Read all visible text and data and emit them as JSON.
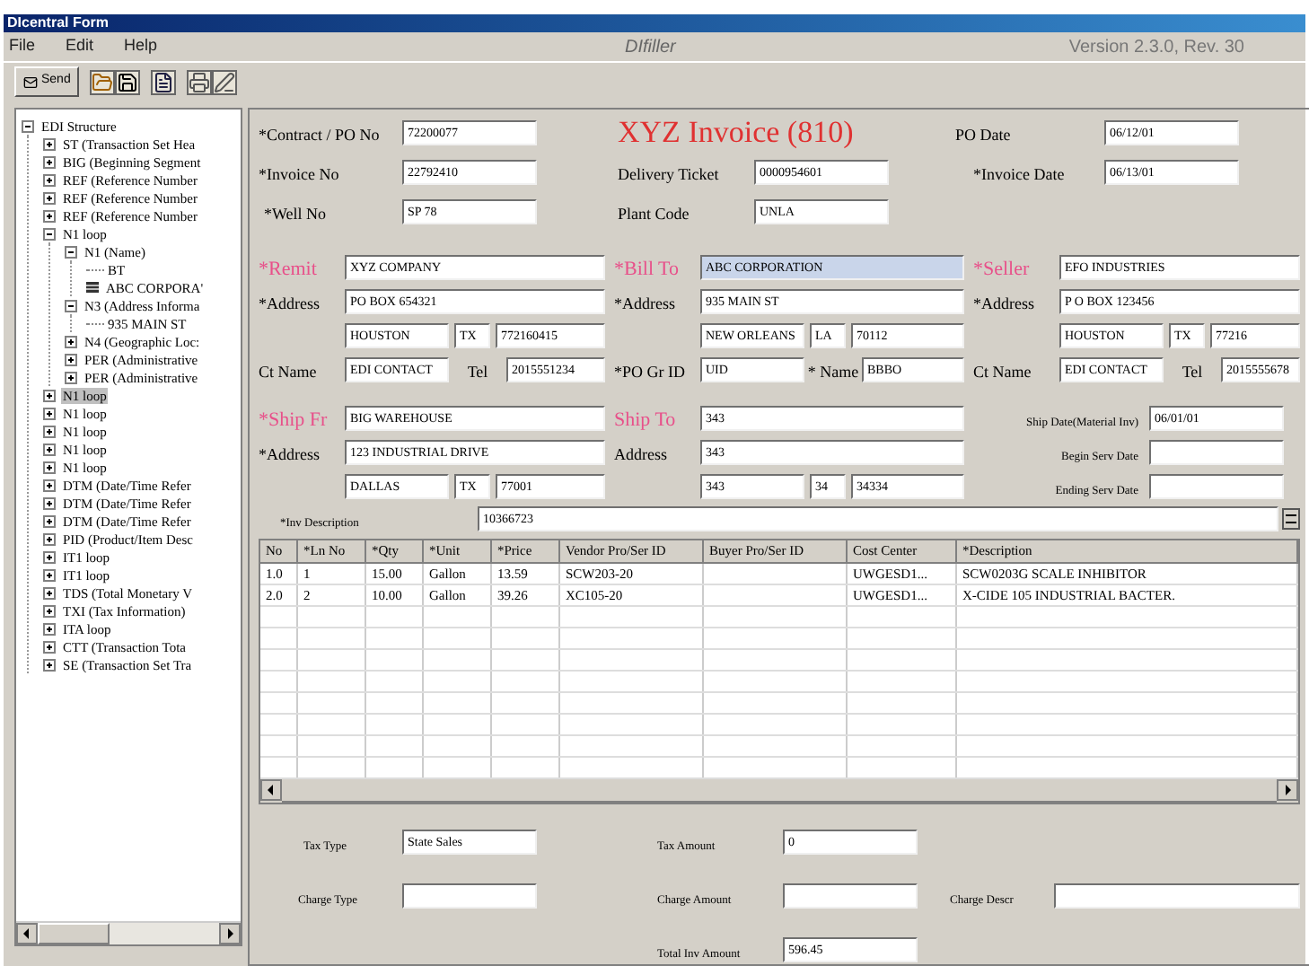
{
  "window": {
    "title": "DIcentral Form"
  },
  "menu": [
    "File",
    "Edit",
    "Help"
  ],
  "app_name": "DIfiller",
  "version": "Version 2.3.0, Rev. 30",
  "toolbar": {
    "send_label": "Send"
  },
  "tree": [
    {
      "label": "EDI Structure",
      "kind": "node",
      "expanded": true,
      "selected": false,
      "children": [
        {
          "label": "ST (Transaction Set Hea",
          "kind": "node",
          "expanded": false,
          "selected": false
        },
        {
          "label": "BIG (Beginning Segment",
          "kind": "node",
          "expanded": false,
          "selected": false
        },
        {
          "label": "REF (Reference Number",
          "kind": "node",
          "expanded": false,
          "selected": false
        },
        {
          "label": "REF (Reference Number",
          "kind": "node",
          "expanded": false,
          "selected": false
        },
        {
          "label": "REF (Reference Number",
          "kind": "node",
          "expanded": false,
          "selected": false
        },
        {
          "label": "N1 loop",
          "kind": "node",
          "expanded": true,
          "selected": false,
          "children": [
            {
              "label": "N1 (Name)",
              "kind": "node",
              "expanded": true,
              "selected": false,
              "children": [
                {
                  "label": "BT",
                  "kind": "leaf",
                  "selected": false
                },
                {
                  "label": "ABC CORPORA'",
                  "kind": "record",
                  "selected": false
                }
              ]
            },
            {
              "label": "N3 (Address Informa",
              "kind": "node",
              "expanded": true,
              "selected": false,
              "children": [
                {
                  "label": "935 MAIN ST",
                  "kind": "leaf",
                  "selected": false
                }
              ]
            },
            {
              "label": "N4 (Geographic Loc:",
              "kind": "node",
              "expanded": false,
              "selected": false
            },
            {
              "label": "PER (Administrative",
              "kind": "node",
              "expanded": false,
              "selected": false
            },
            {
              "label": "PER (Administrative",
              "kind": "node",
              "expanded": false,
              "selected": false
            }
          ]
        },
        {
          "label": "N1 loop",
          "kind": "node",
          "expanded": false,
          "selected": true
        },
        {
          "label": "N1 loop",
          "kind": "node",
          "expanded": false,
          "selected": false
        },
        {
          "label": "N1 loop",
          "kind": "node",
          "expanded": false,
          "selected": false
        },
        {
          "label": "N1 loop",
          "kind": "node",
          "expanded": false,
          "selected": false
        },
        {
          "label": "N1 loop",
          "kind": "node",
          "expanded": false,
          "selected": false
        },
        {
          "label": "DTM (Date/Time Refer",
          "kind": "node",
          "expanded": false,
          "selected": false
        },
        {
          "label": "DTM (Date/Time Refer",
          "kind": "node",
          "expanded": false,
          "selected": false
        },
        {
          "label": "DTM (Date/Time Refer",
          "kind": "node",
          "expanded": false,
          "selected": false
        },
        {
          "label": "PID (Product/Item Desc",
          "kind": "node",
          "expanded": false,
          "selected": false
        },
        {
          "label": "IT1 loop",
          "kind": "node",
          "expanded": false,
          "selected": false
        },
        {
          "label": "IT1 loop",
          "kind": "node",
          "expanded": false,
          "selected": false
        },
        {
          "label": "TDS (Total Monetary V",
          "kind": "node",
          "expanded": false,
          "selected": false
        },
        {
          "label": "TXI (Tax Information)",
          "kind": "node",
          "expanded": false,
          "selected": false
        },
        {
          "label": "ITA loop",
          "kind": "node",
          "expanded": false,
          "selected": false
        },
        {
          "label": "CTT (Transaction Tota",
          "kind": "node",
          "expanded": false,
          "selected": false
        },
        {
          "label": "SE (Transaction Set Tra",
          "kind": "node",
          "expanded": false,
          "selected": false
        }
      ]
    }
  ],
  "form": {
    "title": "XYZ Invoice (810)",
    "header_fields": [
      {
        "label": "*Contract / PO No",
        "value": "72200077"
      },
      {
        "label": "PO Date",
        "value": "06/12/01"
      },
      {
        "label": "*Invoice No",
        "value": "22792410"
      },
      {
        "label": "Delivery Ticket",
        "value": "0000954601"
      },
      {
        "label": "*Invoice Date",
        "value": "06/13/01"
      },
      {
        "label": "*Well No",
        "value": "SP 78"
      },
      {
        "label": "Plant Code",
        "value": "UNLA"
      }
    ],
    "parties": [
      {
        "name_label": "*Remit",
        "name": "XYZ COMPANY",
        "focused": false,
        "address_label": "*Address",
        "address": "PO BOX 654321",
        "city": "HOUSTON",
        "state": "TX",
        "zip": "772160415",
        "contacts": [
          {
            "label": "Ct Name",
            "value": "EDI CONTACT"
          },
          {
            "label": "Tel",
            "value": "2015551234"
          }
        ]
      },
      {
        "name_label": "*Bill To",
        "name": "ABC CORPORATION",
        "focused": true,
        "address_label": "*Address",
        "address": "935 MAIN ST",
        "city": "NEW ORLEANS",
        "state": "LA",
        "zip": "70112",
        "contacts": [
          {
            "label": "*PO Gr ID",
            "value": "UID"
          },
          {
            "label": "* Name",
            "value": "BBBO"
          }
        ]
      },
      {
        "name_label": "*Seller",
        "name": "EFO INDUSTRIES",
        "focused": false,
        "address_label": "*Address",
        "address": "P O BOX 123456",
        "city": "HOUSTON",
        "state": "TX",
        "zip": "77216",
        "contacts": [
          {
            "label": "Ct Name",
            "value": "EDI CONTACT"
          },
          {
            "label": "Tel",
            "value": "2015555678"
          }
        ]
      }
    ],
    "shipping": [
      {
        "name_label": "*Ship Fr",
        "name": "BIG WAREHOUSE",
        "focused": false,
        "address_label": "*Address",
        "address": "123 INDUSTRIAL DRIVE",
        "city": "DALLAS",
        "state": "TX",
        "zip": "77001"
      },
      {
        "name_label": "Ship To",
        "name": "343",
        "focused": false,
        "address_label": "Address",
        "address": "343",
        "city": "343",
        "state": "34",
        "zip": "34334"
      }
    ],
    "dates": [
      {
        "label": "Ship Date(Material Inv)",
        "value": "06/01/01"
      },
      {
        "label": "Begin Serv Date"
      },
      {
        "label": "Ending Serv Date"
      }
    ],
    "inv_description": {
      "label": "*Inv Description",
      "value": "10366723"
    },
    "table": {
      "columns": [
        "No",
        "*Ln No",
        "*Qty",
        "*Unit",
        "*Price",
        "Vendor Pro/Ser ID",
        "Buyer Pro/Ser ID",
        "Cost Center",
        "*Description"
      ],
      "rows": [
        [
          "1.0",
          "1",
          "15.00",
          "Gallon",
          "13.59",
          "SCW203-20",
          null,
          "UWGESD1...",
          "SCW0203G SCALE INHIBITOR"
        ],
        [
          "2.0",
          "2",
          "10.00",
          "Gallon",
          "39.26",
          "XC105-20",
          null,
          "UWGESD1...",
          "X-CIDE 105 INDUSTRIAL BACTER."
        ]
      ]
    },
    "totals": [
      {
        "label": "Tax Type",
        "value": "State Sales"
      },
      {
        "label": "Tax Amount",
        "value": "0"
      },
      {
        "label": "Charge Type"
      },
      {
        "label": "Charge Amount"
      },
      {
        "label": "Charge Descr"
      },
      {
        "label": "Total Inv Amount",
        "value": "596.45"
      }
    ]
  }
}
